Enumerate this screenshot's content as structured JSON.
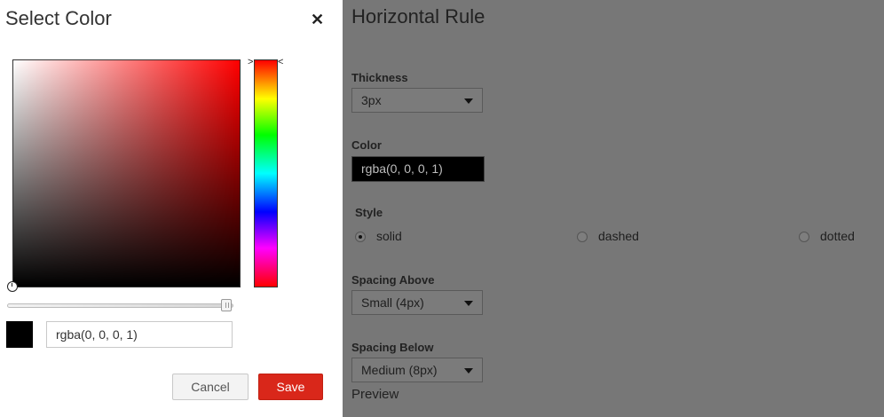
{
  "dialog": {
    "title": "Select Color",
    "close_icon": "close-icon",
    "color_value": "rgba(0, 0, 0, 1)",
    "hue": "#ff0000",
    "alpha": 1,
    "cancel_label": "Cancel",
    "save_label": "Save",
    "save_color": "#d9271a"
  },
  "panel": {
    "title": "Horizontal Rule",
    "thickness": {
      "label": "Thickness",
      "value": "3px"
    },
    "color": {
      "label": "Color",
      "value": "rgba(0, 0, 0, 1)"
    },
    "style": {
      "label": "Style",
      "options": [
        {
          "label": "solid",
          "selected": true
        },
        {
          "label": "dashed",
          "selected": false
        },
        {
          "label": "dotted",
          "selected": false
        }
      ]
    },
    "spacing_above": {
      "label": "Spacing Above",
      "value": "Small (4px)"
    },
    "spacing_below": {
      "label": "Spacing Below",
      "value": "Medium (8px)"
    },
    "preview_label": "Preview"
  }
}
